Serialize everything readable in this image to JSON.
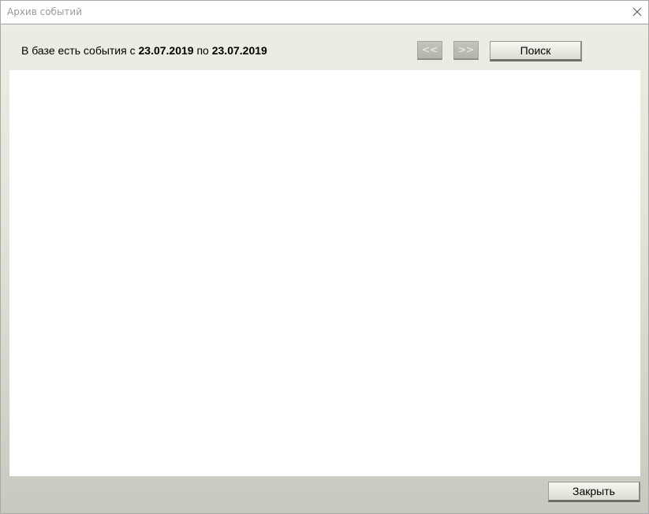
{
  "window": {
    "title": "Архив событий"
  },
  "info": {
    "prefix": "В базе есть события с ",
    "date_from": "23.07.2019",
    "middle": " по ",
    "date_to": "23.07.2019"
  },
  "toolbar": {
    "prev_label": "<<",
    "next_label": ">>",
    "search_label": "Поиск"
  },
  "footer": {
    "close_label": "Закрыть"
  },
  "icons": {
    "close": "close-icon"
  }
}
